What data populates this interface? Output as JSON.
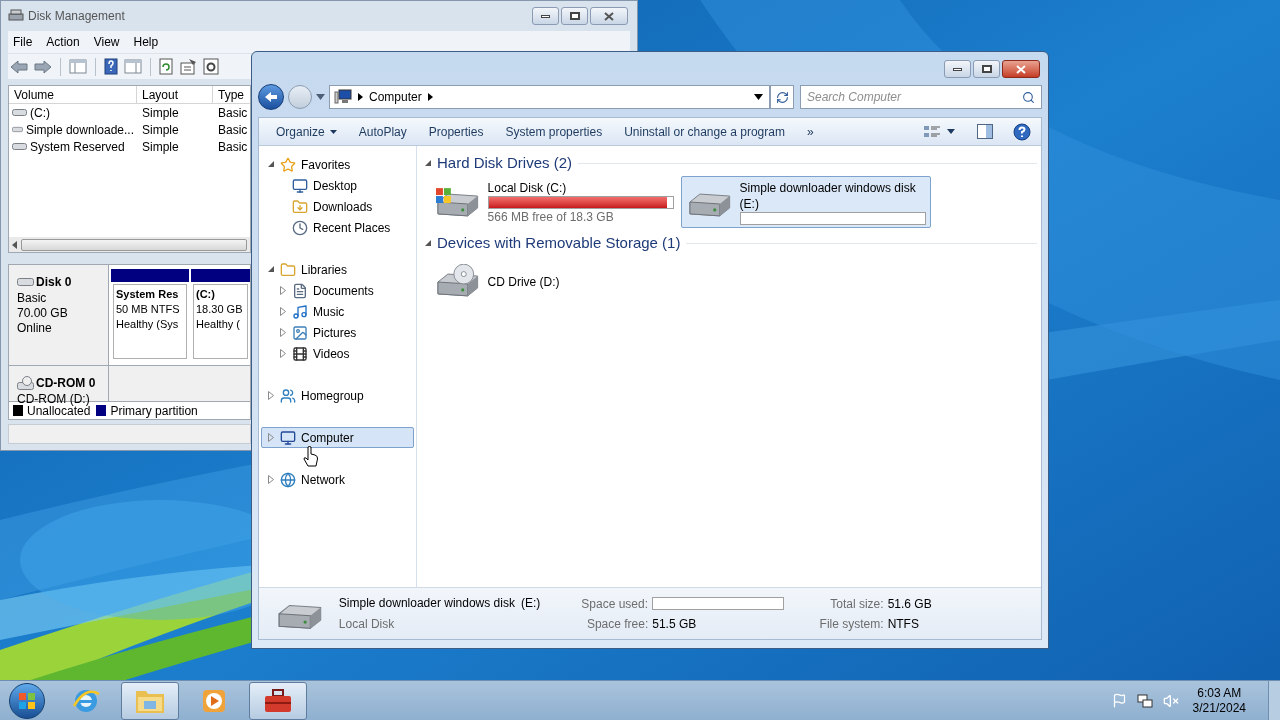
{
  "disk_management": {
    "title": "Disk Management",
    "menu": [
      "File",
      "Action",
      "View",
      "Help"
    ],
    "columns": [
      "Volume",
      "Layout",
      "Type"
    ],
    "volumes": [
      {
        "cells": [
          "(C:)",
          "Simple",
          "Basic"
        ]
      },
      {
        "cells": [
          "Simple downloade...",
          "Simple",
          "Basic"
        ]
      },
      {
        "cells": [
          "System Reserved",
          "Simple",
          "Basic"
        ]
      }
    ],
    "disks": [
      {
        "kind": "disk",
        "name": "Disk 0",
        "details": [
          "Basic",
          "70.00 GB",
          "Online"
        ],
        "partitions": [
          {
            "name": "System Res",
            "size": "50 MB NTFS",
            "status": "Healthy (Sys"
          },
          {
            "name": "(C:)",
            "size": "18.30 GB",
            "status": "Healthy ("
          }
        ]
      },
      {
        "kind": "cdrom",
        "name": "CD-ROM 0",
        "details": [
          "CD-ROM (D:)"
        ]
      }
    ],
    "legend": [
      {
        "label": "Unallocated",
        "color": "#000000"
      },
      {
        "label": "Primary partition",
        "color": "#000080"
      }
    ]
  },
  "explorer": {
    "breadcrumb": "Computer",
    "search": {
      "placeholder": "Search Computer"
    },
    "toolbar": [
      {
        "label": "Organize",
        "dropdown": true
      },
      {
        "label": "AutoPlay",
        "dropdown": false
      },
      {
        "label": "Properties",
        "dropdown": false
      },
      {
        "label": "System properties",
        "dropdown": false
      },
      {
        "label": "Uninstall or change a program",
        "dropdown": false
      },
      {
        "label": "»",
        "dropdown": false
      }
    ],
    "nav": [
      {
        "kind": "favorites",
        "label": "Favorites",
        "selected": false,
        "expanded": true,
        "children": [
          {
            "kind": "desktop",
            "label": "Desktop",
            "selected": false
          },
          {
            "kind": "downloads",
            "label": "Downloads",
            "selected": false
          },
          {
            "kind": "recent",
            "label": "Recent Places",
            "selected": false
          }
        ]
      },
      {
        "kind": "libraries",
        "label": "Libraries",
        "selected": false,
        "expanded": true,
        "children": [
          {
            "kind": "documents",
            "label": "Documents",
            "selected": false,
            "expanded": false
          },
          {
            "kind": "music",
            "label": "Music",
            "selected": false,
            "expanded": false
          },
          {
            "kind": "pictures",
            "label": "Pictures",
            "selected": false,
            "expanded": false
          },
          {
            "kind": "videos",
            "label": "Videos",
            "selected": false,
            "expanded": false
          }
        ]
      },
      {
        "kind": "homegroup",
        "label": "Homegroup",
        "selected": false,
        "expanded": false
      },
      {
        "kind": "computer",
        "label": "Computer",
        "selected": true,
        "expanded": false
      },
      {
        "kind": "network",
        "label": "Network",
        "selected": false,
        "expanded": false
      }
    ],
    "groups": [
      {
        "title": "Hard Disk Drives (2)",
        "items": [
          {
            "kind": "system-disk",
            "name": "Local Disk (C:)",
            "level": 0.97,
            "free": "566 MB free of 18.3 GB",
            "selected": false
          },
          {
            "kind": "disk",
            "name": "Simple downloader windows disk (E:)",
            "level": 0,
            "selected": true
          }
        ]
      },
      {
        "title": "Devices with Removable Storage (1)",
        "items": [
          {
            "kind": "cd",
            "name": "CD Drive (D:)",
            "selected": false
          }
        ]
      }
    ],
    "details": {
      "name": "Simple downloader windows disk",
      "letter": "(E:)",
      "type": "Local Disk",
      "fields": [
        {
          "kind": "bar",
          "label": "Space used:",
          "level": 0
        },
        {
          "kind": "text",
          "label": "Total size:",
          "value": "51.6 GB"
        },
        {
          "kind": "text",
          "label": "Space free:",
          "value": "51.5 GB"
        },
        {
          "kind": "text",
          "label": "File system:",
          "value": "NTFS"
        }
      ]
    }
  },
  "taskbar": {
    "apps": [
      {
        "kind": "ie",
        "active": false
      },
      {
        "kind": "explorer",
        "active": true
      },
      {
        "kind": "media",
        "active": false
      },
      {
        "kind": "toolbox",
        "active": true
      }
    ],
    "time": "6:03 AM",
    "date": "3/21/2024"
  }
}
